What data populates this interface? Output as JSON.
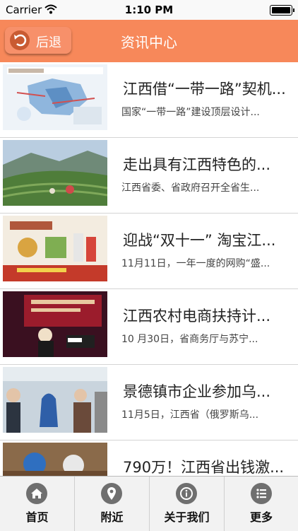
{
  "status": {
    "carrier": "Carrier",
    "time": "1:10 PM"
  },
  "nav": {
    "back_label": "后退",
    "title": "资讯中心"
  },
  "news": [
    {
      "title": "江西借“一带一路”契机...",
      "summary": "国家“一带一路”建设顶层设计...",
      "thumb": "map-infographic"
    },
    {
      "title": "走出具有江西特色的...",
      "summary": "江西省委、省政府召开全省生...",
      "thumb": "tea-plantation"
    },
    {
      "title": "迎战“双十一” 淘宝江...",
      "summary": "11月11日，一年一度的网购“盛...",
      "thumb": "ecommerce-banner"
    },
    {
      "title": "江西农村电商扶持计...",
      "summary": "10 月30日，省商务厅与苏宁...",
      "thumb": "conference-stage"
    },
    {
      "title": "景德镇市企业参加乌...",
      "summary": "11月5日，江西省（俄罗斯乌...",
      "thumb": "porcelain-expo"
    },
    {
      "title": "790万！江西省出钱激...",
      "summary": "",
      "thumb": "people-photo"
    }
  ],
  "tabs": [
    {
      "label": "首页",
      "icon": "home-icon"
    },
    {
      "label": "附近",
      "icon": "location-pin-icon"
    },
    {
      "label": "关于我们",
      "icon": "info-icon"
    },
    {
      "label": "更多",
      "icon": "list-icon"
    }
  ],
  "colors": {
    "nav_bg": "#f7885a",
    "tab_icon": "#6f6f6f"
  }
}
